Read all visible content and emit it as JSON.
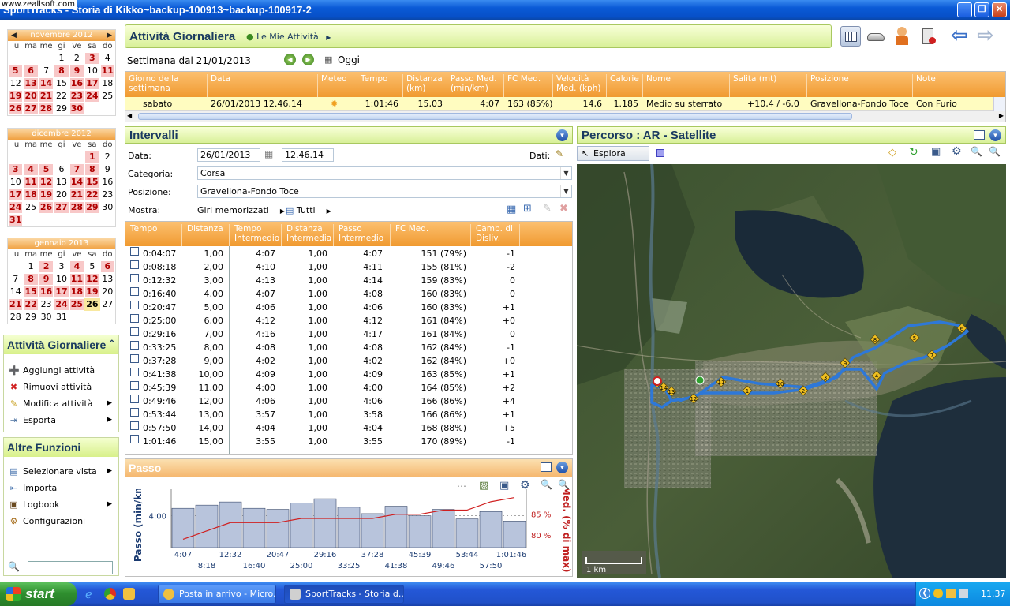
{
  "window": {
    "title": "SportTracks - Storia di Kikko~backup-100913~backup-100917-2",
    "watermark": "www.zeallsoft.com"
  },
  "calendars": [
    {
      "month": "novembre 2012",
      "dows": [
        "lu",
        "ma",
        "me",
        "gi",
        "ve",
        "sa",
        "do"
      ],
      "cells": [
        [
          "",
          "",
          "",
          "1",
          "2",
          "3",
          "4"
        ],
        [
          "5",
          "6",
          "7",
          "8",
          "9",
          "10",
          "11"
        ],
        [
          "12",
          "13",
          "14",
          "15",
          "16",
          "17",
          "18"
        ],
        [
          "19",
          "20",
          "21",
          "22",
          "23",
          "24",
          "25"
        ],
        [
          "26",
          "27",
          "28",
          "29",
          "30",
          "",
          ""
        ]
      ]
    },
    {
      "month": "dicembre 2012",
      "dows": [
        "lu",
        "ma",
        "me",
        "gi",
        "ve",
        "sa",
        "do"
      ],
      "cells": [
        [
          "",
          "",
          "",
          "",
          "",
          "1",
          "2"
        ],
        [
          "3",
          "4",
          "5",
          "6",
          "7",
          "8",
          "9"
        ],
        [
          "10",
          "11",
          "12",
          "13",
          "14",
          "15",
          "16"
        ],
        [
          "17",
          "18",
          "19",
          "20",
          "21",
          "22",
          "23"
        ],
        [
          "24",
          "25",
          "26",
          "27",
          "28",
          "29",
          "30"
        ],
        [
          "31",
          "",
          "",
          "",
          "",
          "",
          ""
        ]
      ]
    },
    {
      "month": "gennaio 2013",
      "dows": [
        "lu",
        "ma",
        "me",
        "gi",
        "ve",
        "sa",
        "do"
      ],
      "cells": [
        [
          "",
          "1",
          "2",
          "3",
          "4",
          "5",
          "6"
        ],
        [
          "7",
          "8",
          "9",
          "10",
          "11",
          "12",
          "13"
        ],
        [
          "14",
          "15",
          "16",
          "17",
          "18",
          "19",
          "20"
        ],
        [
          "21",
          "22",
          "23",
          "24",
          "25",
          "26",
          "27"
        ],
        [
          "28",
          "29",
          "30",
          "31",
          "",
          "",
          ""
        ]
      ]
    }
  ],
  "sidebar": {
    "daily_title": "Attività Giornaliere",
    "daily_items": [
      {
        "label": "Aggiungi attività",
        "icon": "add-icon"
      },
      {
        "label": "Rimuovi attività",
        "icon": "remove-icon"
      },
      {
        "label": "Modifica attività",
        "icon": "edit-icon"
      },
      {
        "label": "Esporta",
        "icon": "export-icon"
      }
    ],
    "other_title": "Altre Funzioni",
    "other_items": [
      {
        "label": "Selezionare vista",
        "icon": "view-icon"
      },
      {
        "label": "Importa",
        "icon": "import-icon"
      },
      {
        "label": "Logbook",
        "icon": "logbook-icon"
      },
      {
        "label": "Configurazioni",
        "icon": "settings-icon"
      }
    ]
  },
  "header": {
    "title": "Attività Giornaliera",
    "breadcrumb": "Le Mie Attività"
  },
  "week": {
    "label": "Settimana dal 21/01/2013",
    "today": "Oggi"
  },
  "activity_table": {
    "columns": [
      "Giorno della settimana",
      "Data",
      "Meteo",
      "Tempo",
      "Distanza (km)",
      "Passo Med. (min/km)",
      "FC Med.",
      "Velocità Med. (kph)",
      "Calorie",
      "Nome",
      "Salita (mt)",
      "Posizione",
      "Note"
    ],
    "row": [
      "sabato",
      "26/01/2013 12.46.14",
      "",
      "1:01:46",
      "15,03",
      "4:07",
      "163 (85%)",
      "14,6",
      "1.185",
      "Medio su sterrato",
      "+10,4 / -6,0",
      "Gravellona-Fondo Toce",
      "Con Furio"
    ]
  },
  "intervals": {
    "title": "Intervalli",
    "date_label": "Data:",
    "date_value": "26/01/2013",
    "time_value": "12.46.14",
    "data_label": "Dati:",
    "category_label": "Categoria:",
    "category_value": "Corsa",
    "position_label": "Posizione:",
    "position_value": "Gravellona-Fondo Toce",
    "show_label": "Mostra:",
    "show_value": "Giri memorizzati",
    "filter_value": "Tutti",
    "columns": [
      "Tempo",
      "Distanza",
      "Tempo Intermedio",
      "Distanza Intermedia",
      "Passo Intermedio",
      "FC Med.",
      "Camb. di Disliv."
    ],
    "rows": [
      [
        "0:04:07",
        "1,00",
        "4:07",
        "1,00",
        "4:07",
        "151 (79%)",
        "-1"
      ],
      [
        "0:08:18",
        "2,00",
        "4:10",
        "1,00",
        "4:11",
        "155 (81%)",
        "-2"
      ],
      [
        "0:12:32",
        "3,00",
        "4:13",
        "1,00",
        "4:14",
        "159 (83%)",
        "0"
      ],
      [
        "0:16:40",
        "4,00",
        "4:07",
        "1,00",
        "4:08",
        "160 (83%)",
        "0"
      ],
      [
        "0:20:47",
        "5,00",
        "4:06",
        "1,00",
        "4:06",
        "160 (83%)",
        "+1"
      ],
      [
        "0:25:00",
        "6,00",
        "4:12",
        "1,00",
        "4:12",
        "161 (84%)",
        "+0"
      ],
      [
        "0:29:16",
        "7,00",
        "4:16",
        "1,00",
        "4:17",
        "161 (84%)",
        "0"
      ],
      [
        "0:33:25",
        "8,00",
        "4:08",
        "1,00",
        "4:08",
        "162 (84%)",
        "-1"
      ],
      [
        "0:37:28",
        "9,00",
        "4:02",
        "1,00",
        "4:02",
        "162 (84%)",
        "+0"
      ],
      [
        "0:41:38",
        "10,00",
        "4:09",
        "1,00",
        "4:09",
        "163 (85%)",
        "+1"
      ],
      [
        "0:45:39",
        "11,00",
        "4:00",
        "1,00",
        "4:00",
        "164 (85%)",
        "+2"
      ],
      [
        "0:49:46",
        "12,00",
        "4:06",
        "1,00",
        "4:06",
        "166 (86%)",
        "+4"
      ],
      [
        "0:53:44",
        "13,00",
        "3:57",
        "1,00",
        "3:58",
        "166 (86%)",
        "+1"
      ],
      [
        "0:57:50",
        "14,00",
        "4:04",
        "1,00",
        "4:04",
        "168 (88%)",
        "+5"
      ],
      [
        "1:01:46",
        "15,00",
        "3:55",
        "1,00",
        "3:55",
        "170 (89%)",
        "-1"
      ]
    ]
  },
  "route": {
    "title": "Percorso  : AR - Satellite",
    "explore": "Esplora",
    "scale": "1 km",
    "markers": [
      "1",
      "2",
      "3",
      "4",
      "5",
      "6",
      "7",
      "8",
      "9",
      "10",
      "11",
      "12",
      "13",
      "14",
      "15"
    ]
  },
  "chart_data": {
    "type": "bar",
    "title": "Passo",
    "ylabel": "Passo (min/km)",
    "y2label": "FC Med. (% di max)",
    "ytick": "4:00",
    "y2ticks": [
      "85 %",
      "80 %"
    ],
    "xticks_top": [
      "4:07",
      "12:32",
      "20:47",
      "29:16",
      "37:28",
      "45:39",
      "53:44",
      "1:01:46"
    ],
    "xticks_bottom": [
      "8:18",
      "16:40",
      "25:00",
      "33:25",
      "41:38",
      "49:46",
      "57:50"
    ],
    "categories": [
      "1",
      "2",
      "3",
      "4",
      "5",
      "6",
      "7",
      "8",
      "9",
      "10",
      "11",
      "12",
      "13",
      "14",
      "15"
    ],
    "pace_seconds": [
      247,
      250,
      253,
      247,
      246,
      252,
      256,
      248,
      242,
      249,
      240,
      246,
      237,
      244,
      235
    ],
    "hr_percent": [
      79,
      81,
      83,
      83,
      83,
      84,
      84,
      84,
      84,
      85,
      85,
      86,
      86,
      88,
      89
    ],
    "colors": {
      "bars": "#b8c4dc",
      "hr_line": "#d02020"
    }
  },
  "taskbar": {
    "start": "start",
    "tasks": [
      "Posta in arrivo - Micro...",
      "SportTracks - Storia d..."
    ],
    "clock": "11.37"
  }
}
